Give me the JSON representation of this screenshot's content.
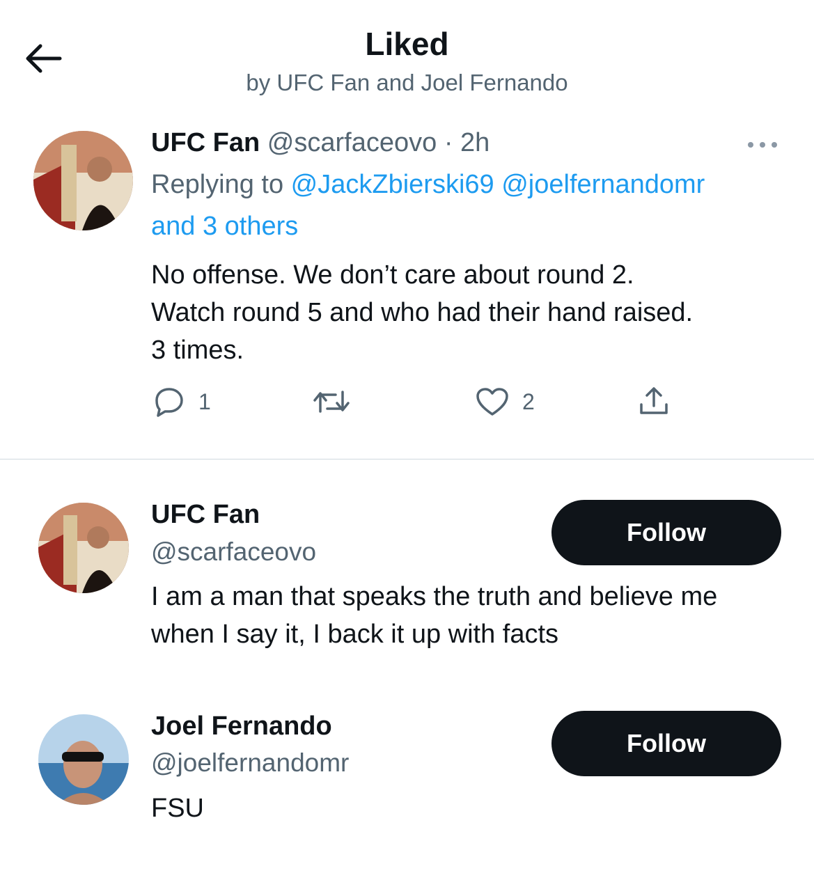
{
  "header": {
    "title": "Liked",
    "subtitle": "by UFC Fan and Joel Fernando"
  },
  "tweet": {
    "name": "UFC Fan",
    "handle": "@scarfaceovo",
    "time": "· 2h",
    "replying_prefix": "Replying to ",
    "mention_1": "@JackZbierski69",
    "mention_2": "@joelfernandomr",
    "mention_others": "and 3 others",
    "text_line_1": "No offense.  We don’t care about round 2.",
    "text_line_2": "Watch round 5 and who had their hand raised.",
    "text_line_3": "3 times.",
    "reply_count": "1",
    "retweet_count": "",
    "like_count": "2"
  },
  "users": [
    {
      "name": "UFC Fan",
      "handle": "@scarfaceovo",
      "bio_line_1": "I am a man that speaks the truth and believe me",
      "bio_line_2": "when I say it, I back it up with facts",
      "follow_label": "Follow"
    },
    {
      "name": "Joel Fernando",
      "handle": "@joelfernandomr",
      "bio_line_1": "FSU",
      "follow_label": "Follow"
    }
  ],
  "icons": {
    "back": "arrow-left-icon",
    "more": "more-horizontal-icon",
    "reply": "reply-icon",
    "retweet": "retweet-icon",
    "like": "heart-icon",
    "share": "share-icon"
  },
  "colors": {
    "text": "#0f1419",
    "secondary": "#536471",
    "link": "#1d9bf0",
    "button_bg": "#0f1419",
    "divider": "#cfd9de"
  }
}
